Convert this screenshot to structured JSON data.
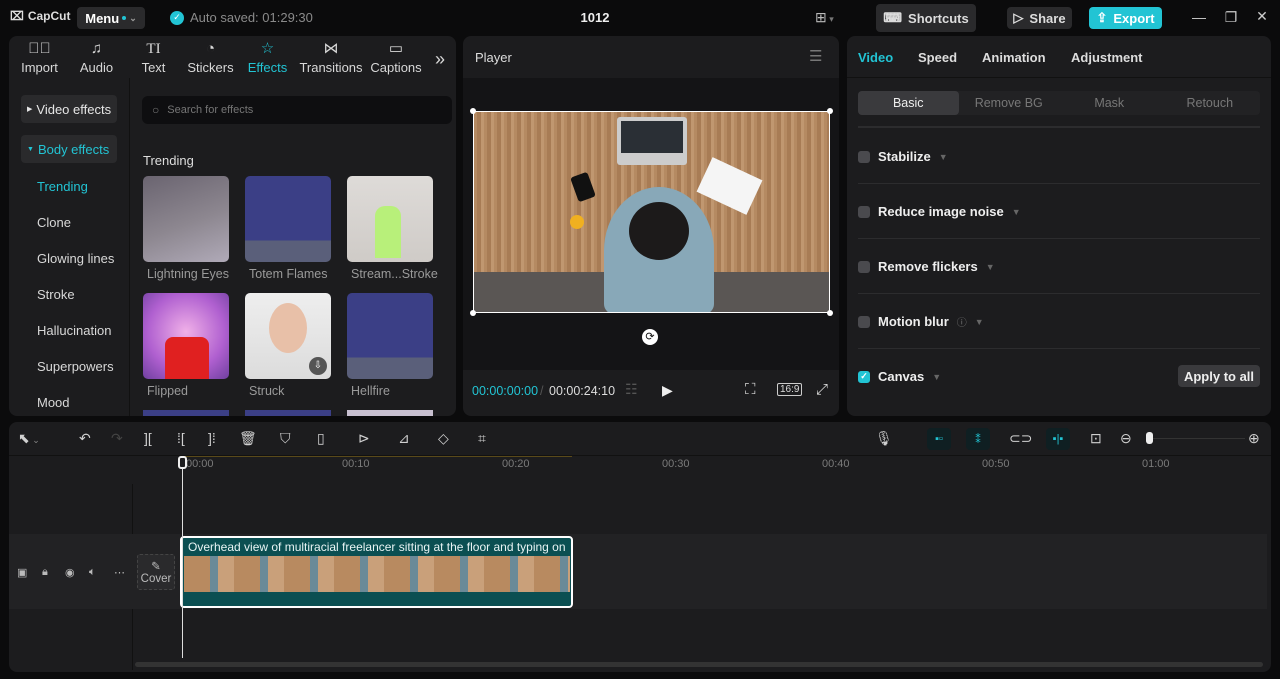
{
  "titlebar": {
    "logo": "CapCut",
    "menu_label": "Menu",
    "autosave": "Auto saved: 01:29:30",
    "project_title": "1012",
    "shortcuts_label": "Shortcuts",
    "share_label": "Share",
    "export_label": "Export"
  },
  "media_tabs": [
    {
      "label": "Import",
      "icon": "import-icon"
    },
    {
      "label": "Audio",
      "icon": "audio-icon"
    },
    {
      "label": "Text",
      "icon": "text-icon"
    },
    {
      "label": "Stickers",
      "icon": "stickers-icon"
    },
    {
      "label": "Effects",
      "icon": "effects-icon",
      "active": true
    },
    {
      "label": "Transitions",
      "icon": "transitions-icon"
    },
    {
      "label": "Captions",
      "icon": "captions-icon"
    }
  ],
  "sidebar": {
    "video_effects": "Video effects",
    "body_effects": "Body effects",
    "items": [
      "Trending",
      "Clone",
      "Glowing lines",
      "Stroke",
      "Hallucination",
      "Superpowers",
      "Mood"
    ]
  },
  "effects": {
    "search_placeholder": "Search for effects",
    "section_title": "Trending",
    "items": [
      "Lightning Eyes",
      "Totem Flames",
      "Stream...Stroke",
      "Flipped",
      "Struck",
      "Hellfire"
    ]
  },
  "player": {
    "title": "Player",
    "current_time": "00:00:00:00",
    "total_time": "00:00:24:10",
    "ratio": "16:9"
  },
  "right_panel": {
    "tabs": [
      "Video",
      "Speed",
      "Animation",
      "Adjustment"
    ],
    "subtabs": [
      "Basic",
      "Remove BG",
      "Mask",
      "Retouch"
    ],
    "options": [
      {
        "label": "Stabilize",
        "checked": false
      },
      {
        "label": "Reduce image noise",
        "checked": false
      },
      {
        "label": "Remove flickers",
        "checked": false
      },
      {
        "label": "Motion blur",
        "checked": false
      },
      {
        "label": "Canvas",
        "checked": true
      }
    ],
    "apply_all": "Apply to all"
  },
  "timeline": {
    "ruler": [
      "00:00",
      "00:10",
      "00:20",
      "00:30",
      "00:40",
      "00:50",
      "01:00"
    ],
    "cover_label": "Cover",
    "clip_title": "Overhead view of multiracial freelancer sitting at the floor and typing on"
  },
  "colors": {
    "accent": "#22c4d4",
    "clip": "#0b4f52"
  }
}
